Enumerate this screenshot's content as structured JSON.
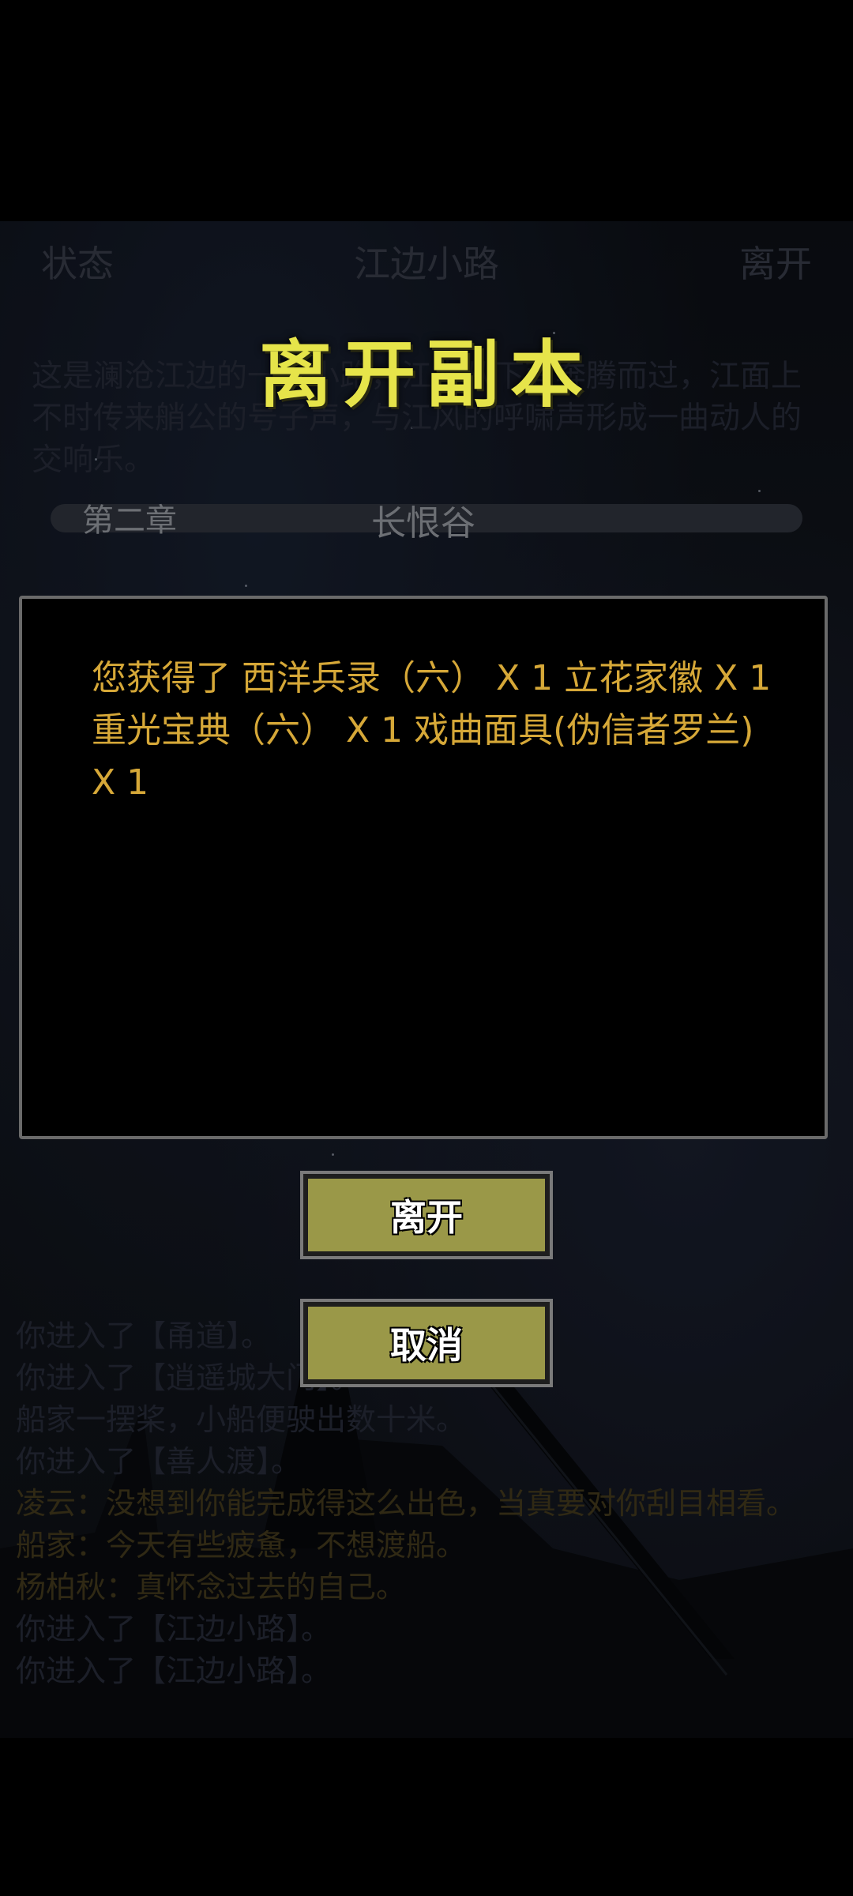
{
  "header": {
    "left": "状态",
    "center": "江边小路",
    "right": "离开"
  },
  "description": "这是澜沧江边的一条小路，江水从下面奔腾而过，江面上不时传来艄公的号子声，与江风的呼啸声形成一曲动人的交响乐。",
  "chapter": {
    "number": "第二章",
    "name": "长恨谷"
  },
  "log": [
    {
      "text": "你进入了【甬道】。",
      "tone": "grey"
    },
    {
      "text": "你进入了【逍遥城大门】。",
      "tone": "grey"
    },
    {
      "text": "船家一摆桨，小船便驶出数十米。",
      "tone": "grey"
    },
    {
      "text": "你进入了【善人渡】。",
      "tone": "grey"
    },
    {
      "text": "凌云：没想到你能完成得这么出色，当真要对你刮目相看。",
      "tone": "yellow"
    },
    {
      "text": "船家：今天有些疲惫，不想渡船。",
      "tone": "yellow"
    },
    {
      "text": "杨柏秋：真怀念过去的自己。",
      "tone": "yellow"
    },
    {
      "text": "你进入了【江边小路】。",
      "tone": "grey"
    },
    {
      "text": "你进入了【江边小路】。",
      "tone": "grey"
    }
  ],
  "modal": {
    "title": "离开副本",
    "message": "您获得了 西洋兵录（六） X 1 立花家徽 X 1 重光宝典（六） X 1 戏曲面具(伪信者罗兰) X 1",
    "confirm_label": "离开",
    "cancel_label": "取消"
  },
  "colors": {
    "title": "#e6e44a",
    "message": "#d6a838",
    "button": "#9a9848"
  }
}
